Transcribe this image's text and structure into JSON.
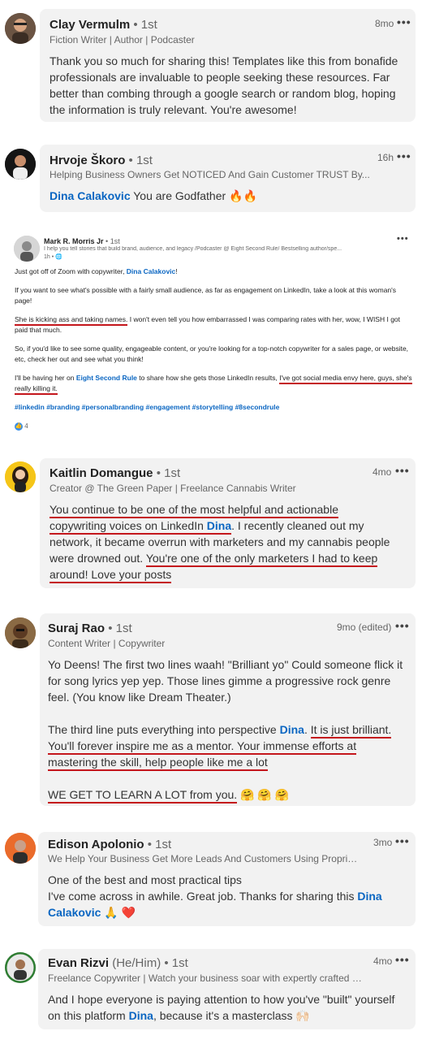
{
  "colors": {
    "card": "#f2f2f2",
    "mention": "#0a66c2",
    "underline": "#c4161c"
  },
  "comments": [
    {
      "name": "Clay Vermulm",
      "degree": "• 1st",
      "headline": "Fiction Writer | Author | Podcaster",
      "time": "8mo",
      "text": "Thank you so much for sharing this! Templates like this from bonafide professionals are invaluable to people seeking these resources. Far better than combing through a google search or random blog, hoping the information is truly relevant. You're awesome!"
    },
    {
      "name": "Hrvoje Škoro",
      "degree": "• 1st",
      "headline": "Helping Business Owners Get NOTICED And Gain Customer TRUST By...",
      "time": "16h",
      "mention": "Dina Calakovic",
      "text": " You are Godfather 🔥🔥"
    },
    {
      "name": "Kaitlin Domangue",
      "degree": "• 1st",
      "headline": "Creator @ The Green Paper | Freelance Cannabis Writer",
      "time": "4mo",
      "text_a": "You continue to be one of the most helpful and actionable",
      "text_b": "copywriting voices on LinkedIn ",
      "mention": "Dina",
      "text_c": ". I recently cleaned out my network, it became overrun with marketers and my cannabis people were drowned out. ",
      "text_d": "You're one of the only marketers I had to keep around! Love your posts"
    },
    {
      "name": "Suraj Rao",
      "degree": "• 1st",
      "headline": "Content Writer | Copywriter",
      "time": "9mo (edited)",
      "text_p1": "Yo Deens! The first two lines waah! \"Brilliant yo\" Could someone flick it for song lyrics yep yep. Those lines gimme a progressive rock genre feel. (You know like Dream Theater.)",
      "text_p2a": "The third line puts everything into perspective ",
      "mention": "Dina",
      "text_p2b": ". ",
      "text_p2c": "It is just brilliant. You'll forever inspire me as a mentor. Your immense efforts at mastering the skill, help people like me a lot",
      "text_p3": "WE GET TO LEARN A LOT from you.",
      "text_p3_emoji": " 🤗 🤗 🤗"
    },
    {
      "name": "Edison Apolonio",
      "degree": "• 1st",
      "headline": "We Help Your Business Get More Leads And Customers Using Proprieta...",
      "time": "3mo",
      "text_a": "One of the best and most practical tips",
      "text_b": "I've come across in awhile. Great job. Thanks for sharing this ",
      "mention": "Dina Calakovic",
      "text_c": " 🙏 ❤️"
    },
    {
      "name": "Evan Rizvi",
      "pronouns": "(He/Him)",
      "degree": "• 1st",
      "headline": "Freelance Copywriter | Watch your business soar with expertly crafted w...",
      "time": "4mo",
      "text_a": "And I hope everyone is paying attention to how you've \"built\" yourself on this platform ",
      "mention": "Dina",
      "text_b": ", because it's a masterclass 🙌🏻"
    }
  ],
  "post": {
    "name": "Mark R. Morris Jr",
    "degree": "• 1st",
    "headline": "I help you tell stories that build brand, audience, and legacy /Podcaster @ Eight Second Rule/ Bestselling author/spe...",
    "time": "1h • 🌐",
    "p1a": "Just got off of Zoom with copywriter, ",
    "p1_mention": "Dina Calakovic",
    "p1b": "!",
    "p2": "If you want to see what's possible with a fairly small audience, as far as engagement on LinkedIn, take a look at this woman's page!",
    "p3a": "She is kicking ass and taking names.",
    "p3b": " I won't even tell you how embarrassed I was comparing rates with her, wow, I WISH I got paid that much.",
    "p4": "So, if you'd like to see some quality, engageable content, or you're looking for a top-notch copywriter for a sales page, or website, etc, check her out and see what you think!",
    "p5a": "I'll be having her on ",
    "p5_mention": "Eight Second Rule",
    "p5b": " to share how she gets those LinkedIn results, ",
    "p5c": "I've got social media envy here, guys, she's really killing it.",
    "hashtags": "#linkedin #branding #personalbranding #engagement #storytelling #8secondrule",
    "reactions": "4"
  }
}
